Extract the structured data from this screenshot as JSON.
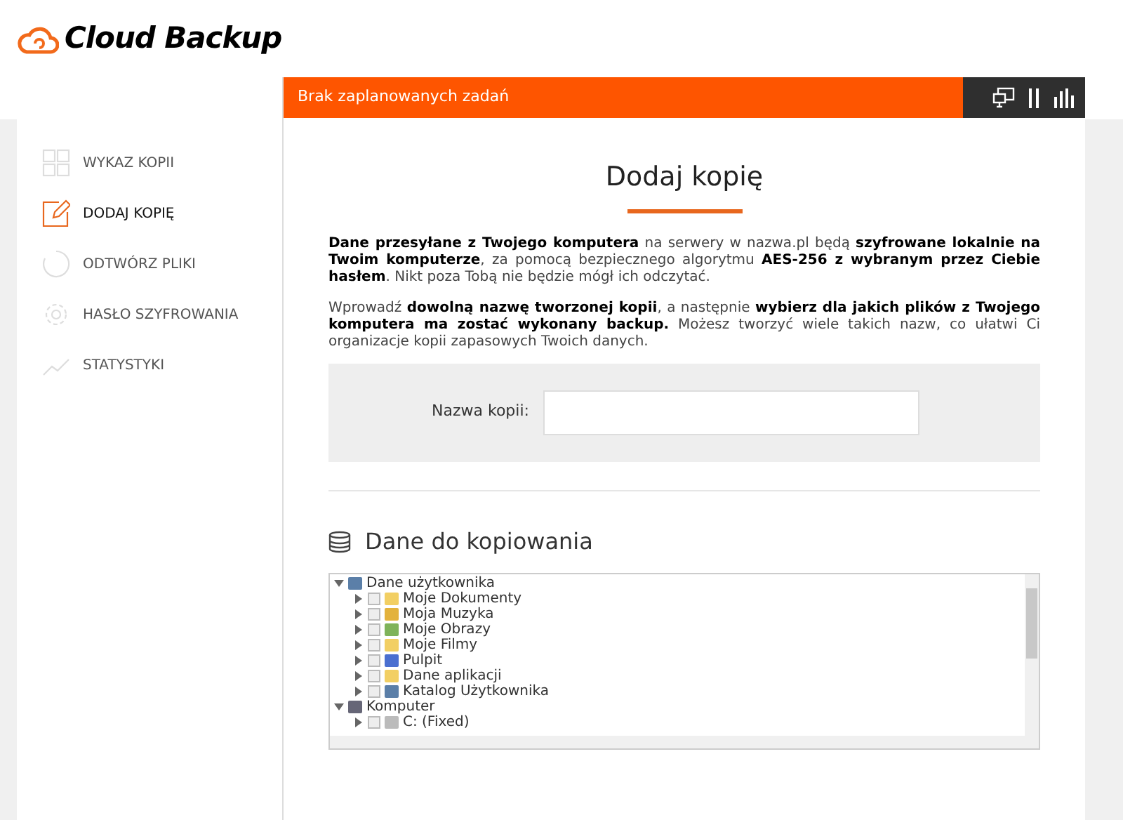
{
  "logo": {
    "text": "Cloud Backup"
  },
  "sidebar": {
    "items": [
      {
        "label": "WYKAZ KOPII",
        "kind": "grid",
        "selected": false
      },
      {
        "label": "DODAJ KOPIĘ",
        "kind": "edit",
        "selected": true
      },
      {
        "label": "ODTWÓRZ PLIKI",
        "kind": "restore",
        "selected": false
      },
      {
        "label": "HASŁO SZYFROWANIA",
        "kind": "gear",
        "selected": false
      },
      {
        "label": "STATYSTYKI",
        "kind": "chart",
        "selected": false
      }
    ]
  },
  "status_bar": {
    "text": "Brak zaplanowanych zadań"
  },
  "page": {
    "title": "Dodaj kopię",
    "paragraphs": [
      "**Dane przesyłane z Twojego komputera** na serwery w nazwa.pl będą **szyfrowane lokalnie na Twoim komputerze**, za pomocą bezpiecznego algorytmu **AES-256 z wybranym przez Ciebie hasłem**. Nikt poza Tobą nie będzie mógł ich odczytać.",
      "Wprowadź **dowolną nazwę tworzonej kopii**, a następnie **wybierz dla jakich plików z Twojego komputera ma zostać wykonany backup.** Możesz tworzyć wiele takich nazw, co ułatwi Ci organizacje kopii zapasowych Twoich danych."
    ],
    "name_field": {
      "label": "Nazwa kopii:"
    },
    "section_title": "Dane do kopiowania"
  },
  "tree": [
    {
      "label": "Dane użytkownika",
      "kind": "user",
      "expanded": true,
      "children": [
        {
          "label": "Moje Dokumenty",
          "kind": "folder",
          "expanded": false,
          "checked": false
        },
        {
          "label": "Moja Muzyka",
          "kind": "music",
          "expanded": false,
          "checked": false
        },
        {
          "label": "Moje Obrazy",
          "kind": "image",
          "expanded": false,
          "checked": false
        },
        {
          "label": "Moje Filmy",
          "kind": "folder",
          "expanded": false,
          "checked": false
        },
        {
          "label": "Pulpit",
          "kind": "desktop",
          "expanded": false,
          "checked": false
        },
        {
          "label": "Dane aplikacji",
          "kind": "folder",
          "expanded": false,
          "checked": false
        },
        {
          "label": "Katalog Użytkownika",
          "kind": "user",
          "expanded": false,
          "checked": false
        }
      ]
    },
    {
      "label": "Komputer",
      "kind": "computer",
      "expanded": true,
      "children": [
        {
          "label": "C: (Fixed)",
          "kind": "drive",
          "expanded": false,
          "checked": false
        }
      ]
    }
  ]
}
